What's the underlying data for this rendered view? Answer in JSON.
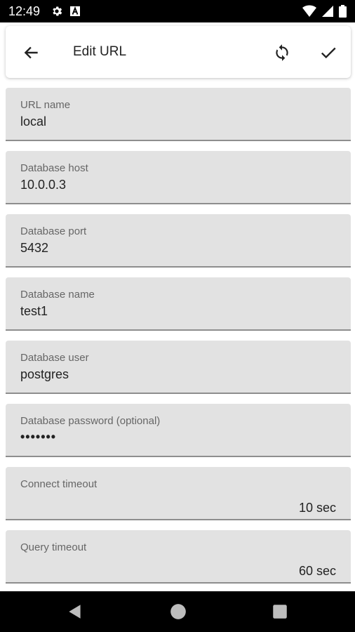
{
  "status_bar": {
    "time": "12:49",
    "icons_left": [
      "settings-icon",
      "font-icon"
    ],
    "icons_right": [
      "wifi-icon",
      "signal-icon",
      "battery-icon"
    ]
  },
  "app_bar": {
    "title": "Edit URL",
    "back_icon": "arrow-back-icon",
    "refresh_icon": "refresh-icon",
    "confirm_icon": "check-icon"
  },
  "fields": [
    {
      "label": "URL name",
      "value": "local"
    },
    {
      "label": "Database host",
      "value": "10.0.0.3"
    },
    {
      "label": "Database port",
      "value": "5432"
    },
    {
      "label": "Database name",
      "value": "test1"
    },
    {
      "label": "Database user",
      "value": "postgres"
    },
    {
      "label": "Database password (optional)",
      "value": "•••••••"
    },
    {
      "label": "Connect timeout",
      "value": "10 sec"
    },
    {
      "label": "Query timeout",
      "value": "60 sec"
    }
  ],
  "nav_bar": {
    "icons": [
      "nav-back-icon",
      "nav-home-icon",
      "nav-recents-icon"
    ]
  },
  "colors": {
    "status_bar_bg": "#000000",
    "field_bg": "#e2e2e2",
    "field_underline": "#8e8e8e",
    "label_text": "#666666",
    "value_text": "#222222"
  }
}
